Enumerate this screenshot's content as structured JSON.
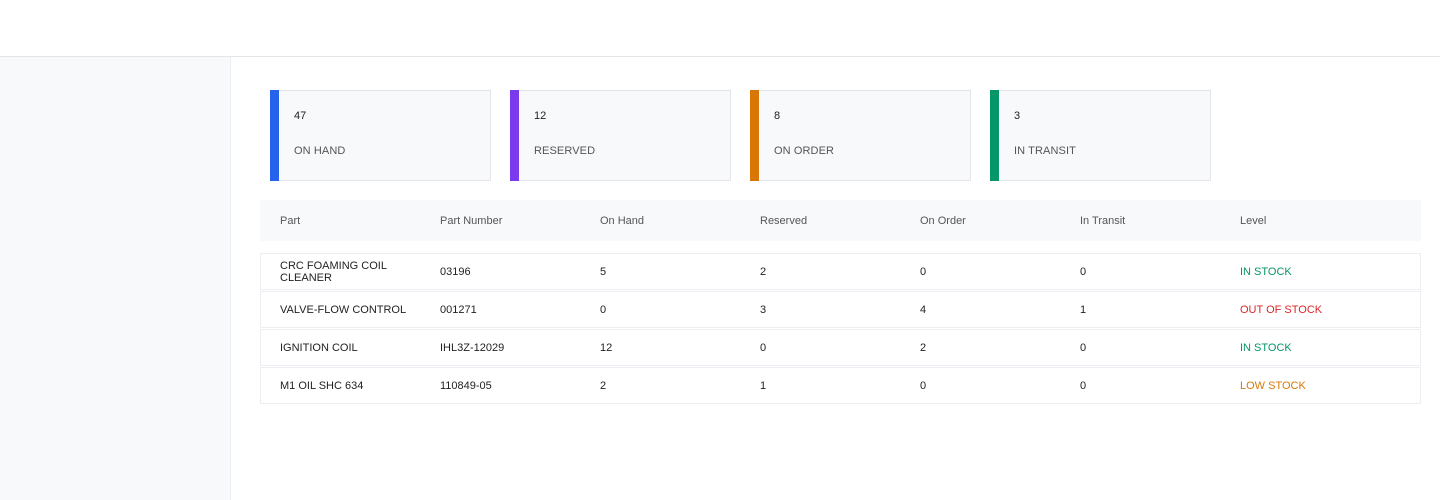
{
  "summary_cards": [
    {
      "value": "47",
      "label": "ON HAND",
      "color": "#2563eb"
    },
    {
      "value": "12",
      "label": "RESERVED",
      "color": "#7c3aed"
    },
    {
      "value": "8",
      "label": "ON ORDER",
      "color": "#d97706"
    },
    {
      "value": "3",
      "label": "IN TRANSIT",
      "color": "#059669"
    }
  ],
  "table": {
    "headers": [
      "Part",
      "Part Number",
      "On Hand",
      "Reserved",
      "On Order",
      "In Transit",
      "Level"
    ],
    "rows": [
      {
        "part": "CRC FOAMING COIL CLEANER",
        "part_number": "03196",
        "on_hand": "5",
        "reserved": "2",
        "on_order": "0",
        "in_transit": "0",
        "level": "IN STOCK",
        "level_color": "#059669"
      },
      {
        "part": "VALVE-FLOW CONTROL",
        "part_number": "001271",
        "on_hand": "0",
        "reserved": "3",
        "on_order": "4",
        "in_transit": "1",
        "level": "OUT OF STOCK",
        "level_color": "#dc2626"
      },
      {
        "part": "IGNITION COIL",
        "part_number": "IHL3Z-12029",
        "on_hand": "12",
        "reserved": "0",
        "on_order": "2",
        "in_transit": "0",
        "level": "IN STOCK",
        "level_color": "#059669"
      },
      {
        "part": "M1 OIL SHC 634",
        "part_number": "110849-05",
        "on_hand": "2",
        "reserved": "1",
        "on_order": "0",
        "in_transit": "0",
        "level": "LOW STOCK",
        "level_color": "#d97706"
      }
    ]
  }
}
